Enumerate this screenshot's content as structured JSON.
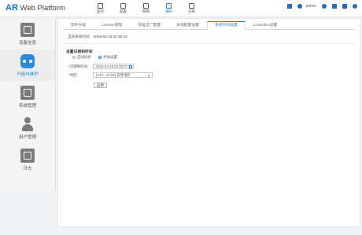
{
  "brand": {
    "ar": "AR",
    "rest": " Web Platform"
  },
  "nav": [
    {
      "label": "监控",
      "icon": "monitor-icon"
    },
    {
      "label": "配置",
      "icon": "config-icon"
    },
    {
      "label": "网络",
      "icon": "network-icon"
    },
    {
      "label": "维护",
      "icon": "maintenance-icon",
      "active": true
    },
    {
      "label": "诊断",
      "icon": "diagnose-icon"
    }
  ],
  "top_right": {
    "user": "admin"
  },
  "sidebar": [
    {
      "label": "设备信息",
      "icon": "device-info-icon"
    },
    {
      "label": "升级与维护",
      "icon": "upgrade-maintenance-icon",
      "active": true
    },
    {
      "label": "系统管理",
      "icon": "system-management-icon"
    },
    {
      "label": "用户管理",
      "icon": "user-management-icon"
    },
    {
      "label": "日志",
      "icon": "log-icon"
    }
  ],
  "tabs": [
    "软件升级",
    "License管理",
    "恢复出厂配置",
    "本地配置设置",
    "系统时间设置",
    "Controller设置"
  ],
  "active_tab": 4,
  "current_time": {
    "label": "当前系统时间:",
    "value": "2018-03-16 02:29:42"
  },
  "section_title": "设置日期和时间",
  "radio": {
    "auto": "自动同步",
    "manual": "手动设置"
  },
  "form": {
    "datetime_label": "日期和时间:",
    "datetime_value": "2018-03-16 02:29:07",
    "timezone_label": "时区:",
    "timezone_value": "(UTC -12:00) 日界线西",
    "apply": "应用"
  },
  "colors": {
    "accent": "#1d84d8",
    "brand": "#0e74c8"
  }
}
